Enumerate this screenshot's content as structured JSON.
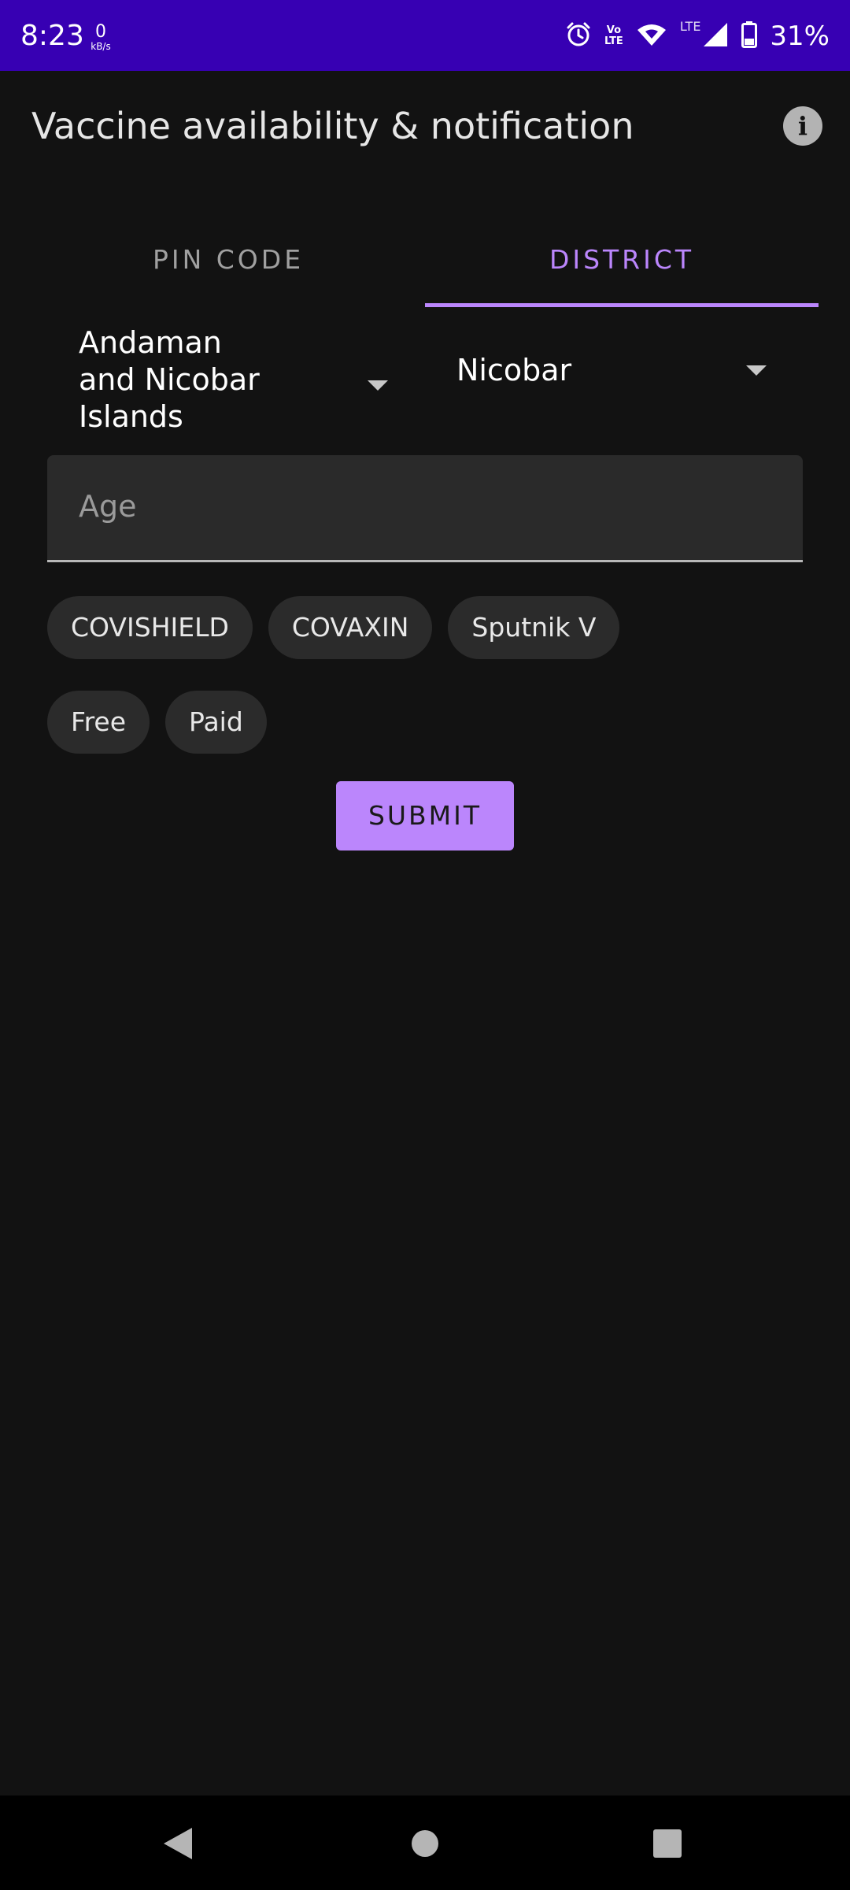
{
  "status_bar": {
    "time": "8:23",
    "net_speed_value": "0",
    "net_speed_unit": "kB/s",
    "volte_top": "Vo",
    "volte_bottom": "LTE",
    "lte_label": "LTE",
    "battery_percent": "31%",
    "icons": [
      "alarm-icon",
      "volte-icon",
      "wifi-icon",
      "signal-icon",
      "battery-icon"
    ]
  },
  "app_bar": {
    "title": "Vaccine availability & notification",
    "info_icon_glyph": "i"
  },
  "tabs": [
    {
      "label": "PIN CODE",
      "selected": false
    },
    {
      "label": "DISTRICT",
      "selected": true
    }
  ],
  "form": {
    "state_value": "Andaman and Nicobar Islands",
    "district_value": "Nicobar",
    "age_placeholder": "Age",
    "age_value": ""
  },
  "vaccine_chips": [
    "COVISHIELD",
    "COVAXIN",
    "Sputnik V"
  ],
  "fee_chips": [
    "Free",
    "Paid"
  ],
  "submit_label": "SUBMIT",
  "colors": {
    "status_bar": "#3700b3",
    "background": "#121212",
    "accent": "#bb86fc"
  }
}
